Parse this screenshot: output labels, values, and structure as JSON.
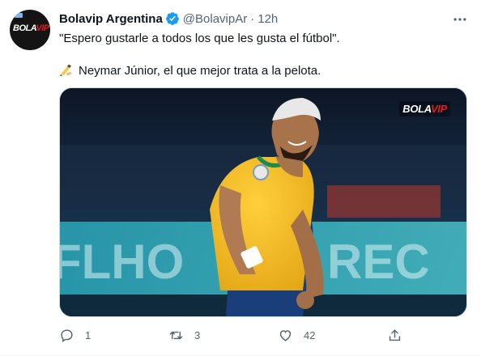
{
  "author": {
    "name": "Bolavip Argentina",
    "handle": "@BolavipAr",
    "separator": "·",
    "time": "12h",
    "avatar_logo": "BOLAVIP",
    "verified_icon": "verified-badge-icon"
  },
  "tweet": {
    "line1": "\"Espero gustarle a todos los que les gusta el fútbol\".",
    "line2": "Neymar Júnior, el que mejor trata a la pelota.",
    "line2_emoji_icon": "writing-hand-icon"
  },
  "media": {
    "watermark": "BOLAVIP",
    "description_icon": "photo"
  },
  "actions": {
    "reply_count": "1",
    "retweet_count": "3",
    "like_count": "42"
  },
  "colors": {
    "text": "#0f1419",
    "secondary": "#536471",
    "verified": "#1d9bf0",
    "brand_red": "#e21b22"
  }
}
